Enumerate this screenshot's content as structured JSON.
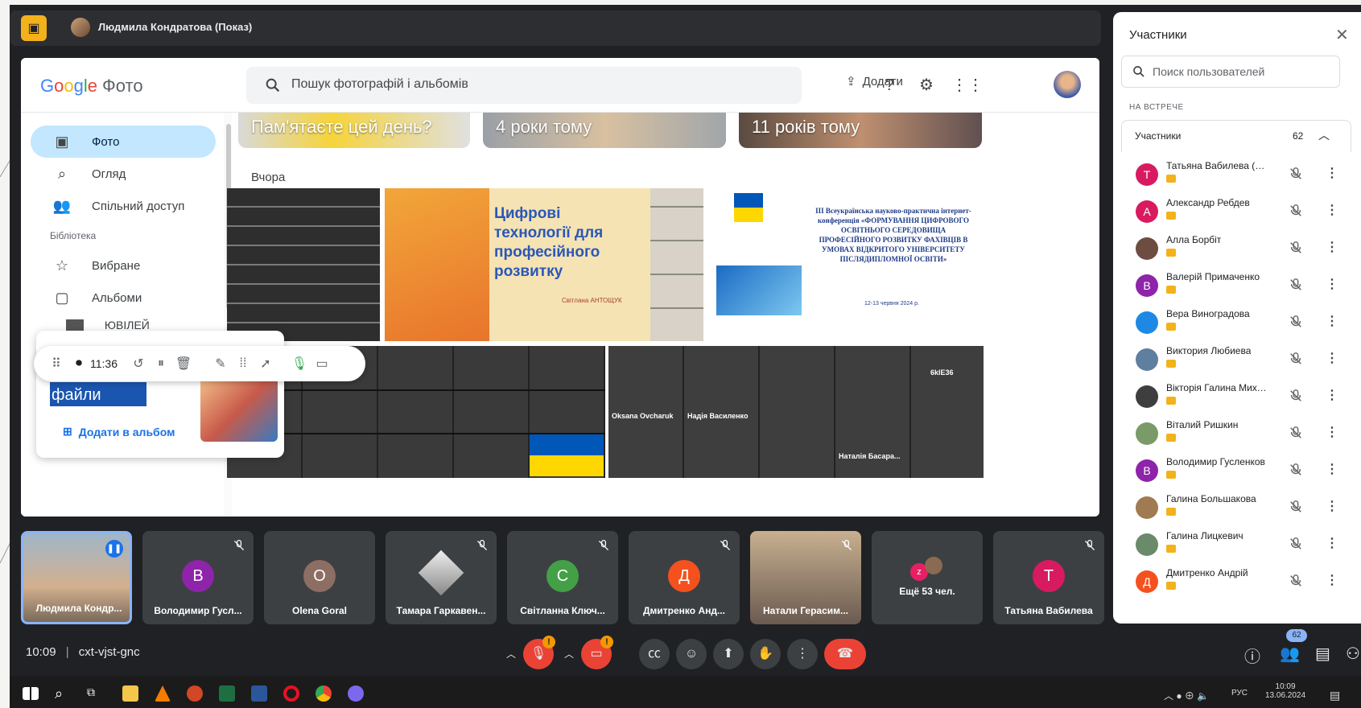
{
  "meet": {
    "presenter": "Людмила Кондратова (Показ)",
    "meeting_code": "cxt-vjst-gnc",
    "time": "10:09",
    "participants_badge": "62"
  },
  "photos": {
    "logo_google": "Google",
    "logo_product": "Фото",
    "search_placeholder": "Пошук фотографій і альбомів",
    "add_label": "Додати",
    "nav": [
      {
        "label": "Фото",
        "icon": "photo-icon"
      },
      {
        "label": "Огляд",
        "icon": "search-icon"
      },
      {
        "label": "Спільний доступ",
        "icon": "people-icon"
      }
    ],
    "library_label": "Бібліотека",
    "favorites_label": "Вибране",
    "albums_label": "Альбоми",
    "album_item": "ЮВІЛЕЙ",
    "memories": [
      "Пам'ятаєте цей день?",
      "4 роки тому",
      "11 років тому"
    ],
    "date_label": "Вчора",
    "slide_title": "Цифрові технології для професійного розвитку",
    "slide_author": "Світлана АНТОЩУК",
    "conference_title": "III Всеукраїнська науково-практична інтернет-конференція «ФОРМУВАННЯ ЦИФРОВОГО ОСВІТНЬОГО СЕРЕДОВИЩА ПРОФЕСІЙНОГО РОЗВИТКУ ФАХІВЦІВ В УМОВАХ ВІДКРИТОГО УНІВЕРСИТЕТУ ПІСЛЯДИПЛОМНОЇ ОСВІТИ»",
    "conference_dates": "12-13 червня 2024 р.",
    "grid_names": [
      "Oksana Ovcharuk",
      "Надія Василенко",
      "Наталія Басара...",
      "6klE36"
    ]
  },
  "recorder": {
    "time": "11:36",
    "files_label": "файли",
    "add_to_album": "Додати в альбом"
  },
  "panel": {
    "title": "Участники",
    "search_placeholder": "Поиск пользователей",
    "section": "НА ВСТРЕЧЕ",
    "group_label": "Участники",
    "group_count": "62",
    "people": [
      {
        "name": "Татьяна Вабилева (вы)",
        "initial": "Т",
        "color": "#d81b60"
      },
      {
        "name": "Александр Ребдев",
        "initial": "А",
        "color": "#d81b60"
      },
      {
        "name": "Алла Борбіт",
        "initial": "",
        "color": "#6d4c41"
      },
      {
        "name": "Валерій Примаченко",
        "initial": "В",
        "color": "#8e24aa"
      },
      {
        "name": "Вера Виноградова",
        "initial": "",
        "color": "#1e88e5"
      },
      {
        "name": "Виктория Любиева",
        "initial": "",
        "color": "#5f7fa0"
      },
      {
        "name": "Вікторія Галина Михал...",
        "initial": "",
        "color": "#3e3e3e"
      },
      {
        "name": "Віталий Ришкин",
        "initial": "",
        "color": "#7a9a6a"
      },
      {
        "name": "Володимир Гусленков",
        "initial": "В",
        "color": "#8e24aa"
      },
      {
        "name": "Галина Большакова",
        "initial": "",
        "color": "#a07a50"
      },
      {
        "name": "Галина Лицкевич",
        "initial": "",
        "color": "#6a8a6a"
      },
      {
        "name": "Дмитренко Андрій",
        "initial": "Д",
        "color": "#f4511e"
      }
    ]
  },
  "tiles": [
    {
      "name": "Людмила Кондр...",
      "initial": "",
      "color": ""
    },
    {
      "name": "Володимир Гусл...",
      "initial": "В",
      "color": "#8e24aa"
    },
    {
      "name": "Olena Goral",
      "initial": "О",
      "color": "#8d6e63"
    },
    {
      "name": "Тамара Гаркавен...",
      "initial": "",
      "color": ""
    },
    {
      "name": "Світланна Ключ...",
      "initial": "С",
      "color": "#43a047"
    },
    {
      "name": "Дмитренко Анд...",
      "initial": "Д",
      "color": "#f4511e"
    },
    {
      "name": "Натали Герасим...",
      "initial": "",
      "color": ""
    },
    {
      "name": "Ещё 53 чел.",
      "initial": "",
      "color": ""
    },
    {
      "name": "Татьяна Вабилева",
      "initial": "Т",
      "color": "#d81b60"
    }
  ],
  "taskbar": {
    "lang": "РУС",
    "time": "10:09",
    "date": "13.06.2024"
  }
}
